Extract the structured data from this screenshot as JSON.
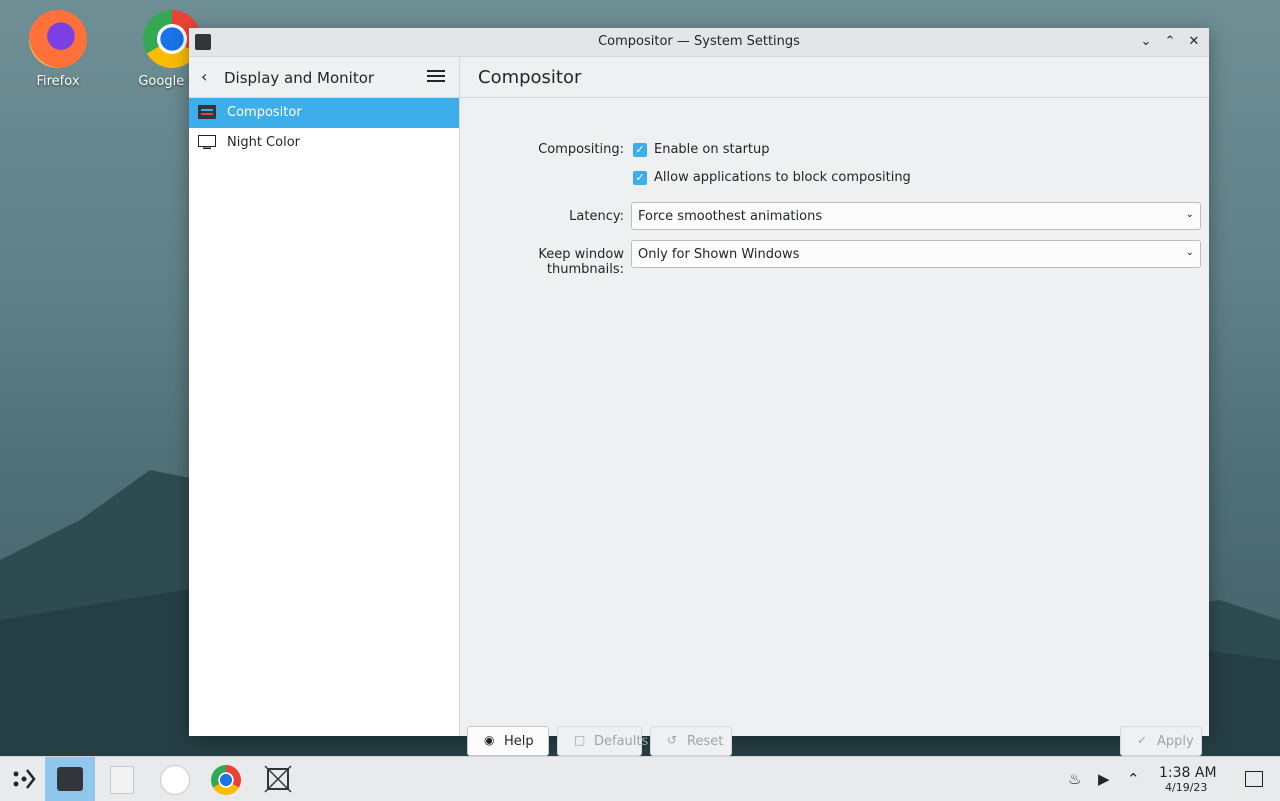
{
  "desktop": {
    "icons": [
      {
        "label": "Firefox"
      },
      {
        "label": "Google Ch"
      }
    ]
  },
  "window": {
    "title": "Compositor — System Settings",
    "sidebar": {
      "back_label": "Display and Monitor",
      "items": [
        {
          "label": "Compositor",
          "active": true
        },
        {
          "label": "Night Color",
          "active": false
        }
      ]
    },
    "content": {
      "heading": "Compositor",
      "compositing_label": "Compositing:",
      "enable_on_startup": "Enable on startup",
      "allow_block": "Allow applications to block compositing",
      "latency_label": "Latency:",
      "latency_value": "Force smoothest animations",
      "thumbnails_label": "Keep window thumbnails:",
      "thumbnails_value": "Only for Shown Windows"
    },
    "buttons": {
      "help": "Help",
      "defaults": "Defaults",
      "reset": "Reset",
      "apply": "Apply"
    }
  },
  "taskbar": {
    "time": "1:38 AM",
    "date": "4/19/23"
  },
  "colors": {
    "accent": "#3daee9",
    "taskbar_active": "#8fc8ec"
  }
}
